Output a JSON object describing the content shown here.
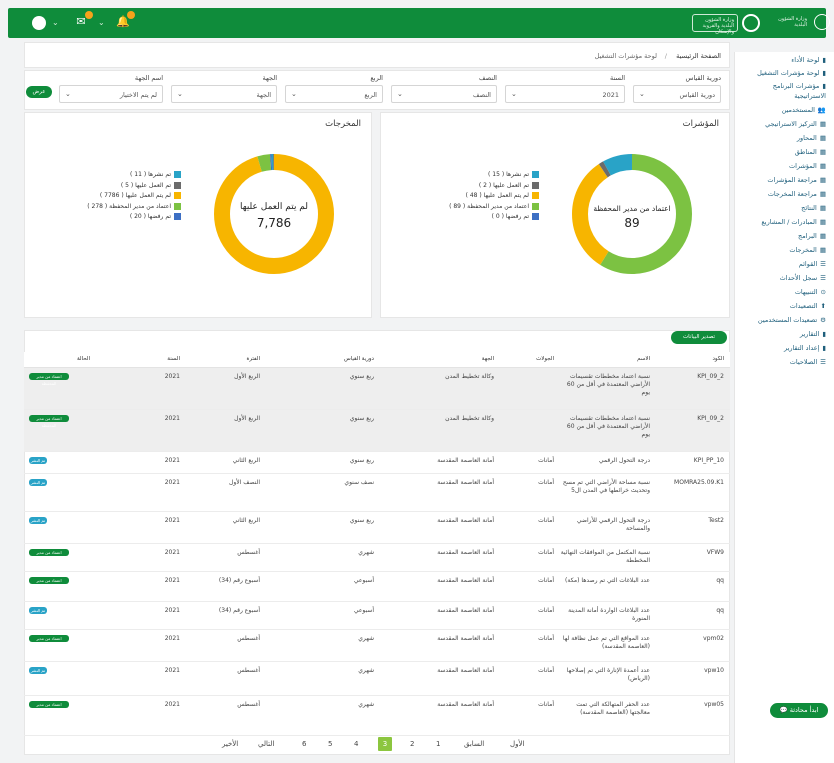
{
  "topbar": {
    "logo_text_1": "وزارة الشؤون البلدية والقروية والإسكان",
    "logo_text_2": "وزارة الشؤون البلدية"
  },
  "breadcrumb": {
    "home": "الصفحة الرئيسية",
    "sep": "/",
    "current": "لوحة مؤشرات التشغيل"
  },
  "sidebar": {
    "items": [
      {
        "label": "لوحة الأداء",
        "icon": "bar-chart-icon"
      },
      {
        "label": "لوحة مؤشرات التشغيل",
        "icon": "bar-chart-icon"
      },
      {
        "label": "مؤشرات البرنامج",
        "icon": "bar-chart-icon"
      },
      {
        "label": "الاستراتيجية",
        "icon": ""
      },
      {
        "label": "المستخدمين",
        "icon": "users-icon"
      },
      {
        "label": "التركيز الاستراتيجي",
        "icon": "grid-icon"
      },
      {
        "label": "المحاور",
        "icon": "grid-icon"
      },
      {
        "label": "المناطق",
        "icon": "grid-icon"
      },
      {
        "label": "المؤشرات",
        "icon": "grid-icon"
      },
      {
        "label": "مراجعة المؤشرات",
        "icon": "grid-icon"
      },
      {
        "label": "مراجعة المخرجات",
        "icon": "grid-icon"
      },
      {
        "label": "النتائج",
        "icon": "grid-icon"
      },
      {
        "label": "المبادرات / المشاريع",
        "icon": "grid-icon"
      },
      {
        "label": "البرامج",
        "icon": "grid-icon"
      },
      {
        "label": "المخرجات",
        "icon": "grid-icon"
      },
      {
        "label": "القوائم",
        "icon": "list-icon"
      },
      {
        "label": "سجل الأحداث",
        "icon": "list-icon"
      },
      {
        "label": "التنبيهات",
        "icon": "bell-icon"
      },
      {
        "label": "التصعيدات",
        "icon": "up-icon"
      },
      {
        "label": "تصعيدات المستخدمين",
        "icon": "gear-icon"
      },
      {
        "label": "التقارير",
        "icon": "file-icon"
      },
      {
        "label": "إعداد التقارير",
        "icon": "file-icon"
      },
      {
        "label": "الصلاحيات",
        "icon": "list-icon"
      }
    ]
  },
  "help_button": "ابدأ محادثة",
  "filters": {
    "period_label": "دورية القياس",
    "period_value": "دورية القياس",
    "year_label": "السنة",
    "year_value": "2021",
    "half_label": "النصف",
    "half_value": "النصف",
    "quarter_label": "الربع",
    "quarter_value": "الربع",
    "entity_label": "الجهة",
    "entity_value": "الجهة",
    "entity_name_label": "اسم الجهة",
    "entity_name_value": "لم يتم الاختيار",
    "show_button": "عرض"
  },
  "indicators_card": {
    "title": "المؤشرات",
    "center_label": "اعتماد من مدير المحفظة",
    "center_value": "89",
    "legend": [
      {
        "label": "تم نشرها ( 15 )",
        "color": "#29a3c7"
      },
      {
        "label": "تم العمل عليها ( 2 )",
        "color": "#6b6b6b"
      },
      {
        "label": "لم يتم العمل عليها ( 48 )",
        "color": "#f7b500"
      },
      {
        "label": "اعتماد من مدير المحفظة ( 89 )",
        "color": "#7cc242"
      },
      {
        "label": "تم رفضها ( 0 )",
        "color": "#3d6fc4"
      }
    ]
  },
  "outputs_card": {
    "title": "المخرجات",
    "center_label": "لم يتم العمل عليها",
    "center_value": "7,786",
    "legend": [
      {
        "label": "تم نشرها ( 11 )",
        "color": "#29a3c7"
      },
      {
        "label": "تم العمل عليها ( 5 )",
        "color": "#6b6b6b"
      },
      {
        "label": "لم يتم العمل عليها ( 7786 )",
        "color": "#f7b500"
      },
      {
        "label": "اعتماد من مدير المحفظة ( 278 )",
        "color": "#7cc242"
      },
      {
        "label": "تم رفضها ( 20 )",
        "color": "#3d6fc4"
      }
    ]
  },
  "export_button": "تصدير البيانات",
  "table": {
    "headers": [
      "الكود",
      "الاسم",
      "الجولات",
      "الجهة",
      "دورية القياس",
      "الفترة",
      "السنة",
      "الحالة"
    ],
    "rows": [
      {
        "code": "KPI_09_2",
        "name": "نسبة اعتماد مخططات تقسيمات الأراضي المعتمدة في أقل من 60 يوم",
        "round": "",
        "entity": "وكالة تخطيط المدن",
        "period": "ربع سنوي",
        "term": "الربع الأول",
        "year": "2021",
        "status": "اعتماد من مدير المحفظة",
        "status_color": "#0f8c3b"
      },
      {
        "code": "KPI_09_2",
        "name": "نسبة اعتماد مخططات تقسيمات الأراضي المعتمدة في أقل من 60 يوم",
        "round": "",
        "entity": "وكالة تخطيط المدن",
        "period": "ربع سنوي",
        "term": "الربع الأول",
        "year": "2021",
        "status": "اعتماد من مدير المحفظة",
        "status_color": "#0f8c3b"
      },
      {
        "code": "KPI_PP_10",
        "name": "درجة التحول الرقمي",
        "round": "أمانات",
        "entity": "أمانة العاصمة المقدسة",
        "period": "ربع سنوي",
        "term": "الربع الثاني",
        "year": "2021",
        "status": "تم النشر",
        "status_color": "#29a3c7"
      },
      {
        "code": "MOMRA25.09.K1",
        "name": "نسبة مساحة الأراضي التي تم مسح وتحديث خرائطها في المدن ال5",
        "round": "أمانات",
        "entity": "أمانة العاصمة المقدسة",
        "period": "نصف سنوي",
        "term": "النصف الأول",
        "year": "2021",
        "status": "تم النشر",
        "status_color": "#29a3c7"
      },
      {
        "code": "Test2",
        "name": "درجة التحول الرقمي للأراضي والمساحة",
        "round": "أمانات",
        "entity": "أمانة العاصمة المقدسة",
        "period": "ربع سنوي",
        "term": "الربع الثاني",
        "year": "2021",
        "status": "تم النشر",
        "status_color": "#29a3c7"
      },
      {
        "code": "VFW9",
        "name": "نسبة المكتمل من الموافقات النهائية المخططة",
        "round": "أمانات",
        "entity": "أمانة العاصمة المقدسة",
        "period": "شهري",
        "term": "أغسطس",
        "year": "2021",
        "status": "اعتماد من مدير المحفظة",
        "status_color": "#0f8c3b"
      },
      {
        "code": "qq",
        "name": "عدد البلاغات التي تم رصدها (مكة)",
        "round": "أمانات",
        "entity": "أمانة العاصمة المقدسة",
        "period": "أسبوعي",
        "term": "أسبوع رقم (34)",
        "year": "2021",
        "status": "اعتماد من مدير المحفظة",
        "status_color": "#0f8c3b"
      },
      {
        "code": "qq",
        "name": "عدد البلاغات الواردة أمانة المدينة المنورة",
        "round": "أمانات",
        "entity": "أمانة العاصمة المقدسة",
        "period": "أسبوعي",
        "term": "أسبوع رقم (34)",
        "year": "2021",
        "status": "تم النشر",
        "status_color": "#29a3c7"
      },
      {
        "code": "vpm02",
        "name": "عدد المواقع التي تم عمل نظافة لها (العاصمة المقدسة)",
        "round": "أمانات",
        "entity": "أمانة العاصمة المقدسة",
        "period": "شهري",
        "term": "أغسطس",
        "year": "2021",
        "status": "اعتماد من مدير المحفظة",
        "status_color": "#0f8c3b"
      },
      {
        "code": "vpw10",
        "name": "عدد أعمدة الإنارة التي تم إصلاحها (الرياض)",
        "round": "أمانات",
        "entity": "أمانة العاصمة المقدسة",
        "period": "شهري",
        "term": "أغسطس",
        "year": "2021",
        "status": "تم النشر",
        "status_color": "#29a3c7"
      },
      {
        "code": "vpw05",
        "name": "عدد الحفر المتهالكة التي تمت معالجتها (العاصمة المقدسة)",
        "round": "أمانات",
        "entity": "أمانة العاصمة المقدسة",
        "period": "شهري",
        "term": "أغسطس",
        "year": "2021",
        "status": "اعتماد من مدير المحفظة",
        "status_color": "#0f8c3b"
      }
    ]
  },
  "pagination": {
    "first": "الأول",
    "prev": "السابق",
    "pages": [
      "1",
      "2",
      "3",
      "4",
      "5",
      "6"
    ],
    "current": "3",
    "next": "التالي",
    "last": "الأخير"
  }
}
